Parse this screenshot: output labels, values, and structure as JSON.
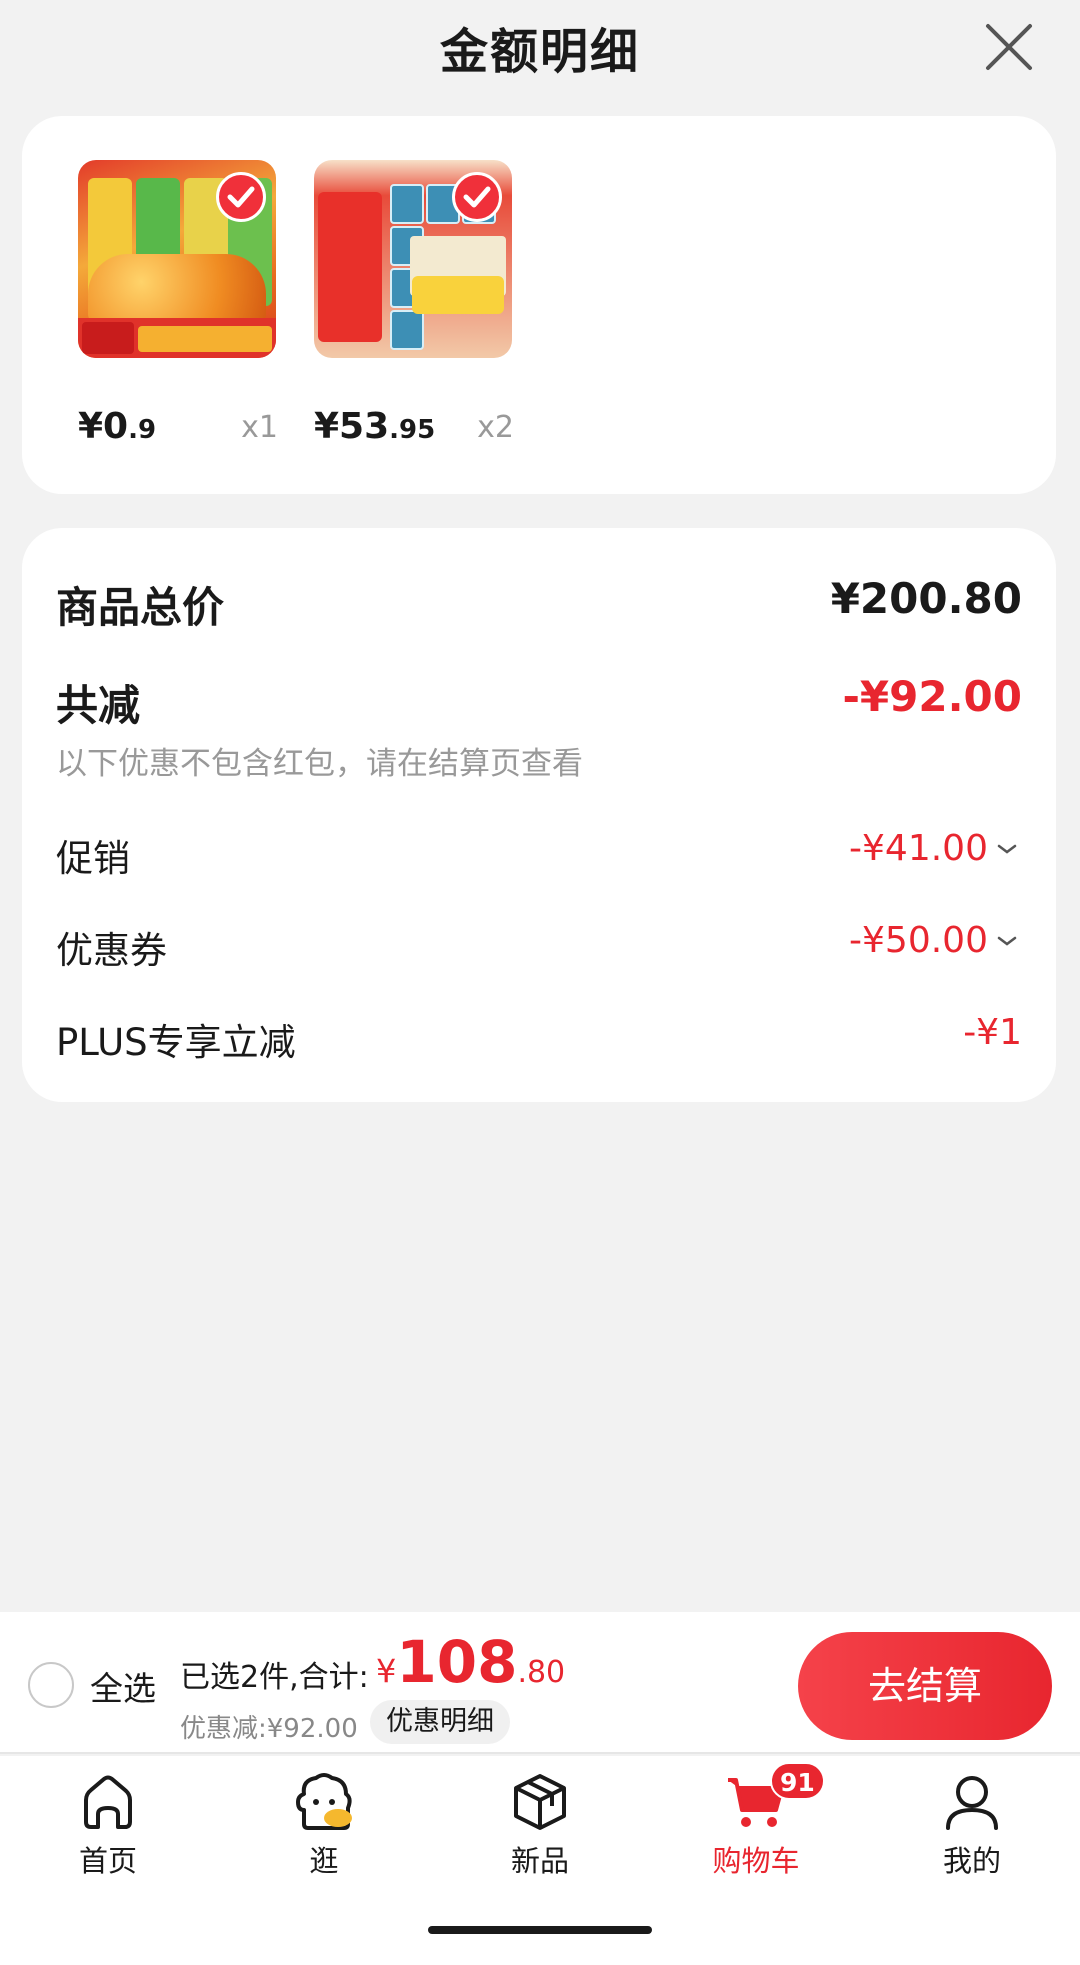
{
  "header": {
    "title": "金额明细"
  },
  "products": [
    {
      "price_int": "¥0",
      "price_dec": ".9",
      "qty": "x1"
    },
    {
      "price_int": "¥53",
      "price_dec": ".95",
      "qty": "x2"
    }
  ],
  "totals": {
    "total_label": "商品总价",
    "total_value": "¥200.80",
    "reduce_label": "共减",
    "reduce_value": "-¥92.00",
    "note": "以下优惠不包含红包，请在结算页查看",
    "promo_label": "促销",
    "promo_value": "-¥41.00",
    "coupon_label": "优惠券",
    "coupon_value": "-¥50.00",
    "plus_label": "PLUS专享立减",
    "plus_value": "-¥1"
  },
  "action_bar": {
    "select_all": "全选",
    "selected_text": "已选2件,合计:",
    "total_yen": "¥",
    "total_int": "108",
    "total_dec": ".80",
    "discount_text": "优惠减:¥92.00",
    "detail_label": "优惠明细",
    "checkout_label": "去结算"
  },
  "tabs": [
    {
      "label": "首页",
      "icon": "home-icon"
    },
    {
      "label": "逛",
      "icon": "browse-icon"
    },
    {
      "label": "新品",
      "icon": "box-icon"
    },
    {
      "label": "购物车",
      "icon": "cart-icon",
      "badge": "91",
      "active": true
    },
    {
      "label": "我的",
      "icon": "user-icon"
    }
  ],
  "colors": {
    "accent": "#e8262f",
    "background": "#f2f2f2",
    "card": "#ffffff"
  }
}
